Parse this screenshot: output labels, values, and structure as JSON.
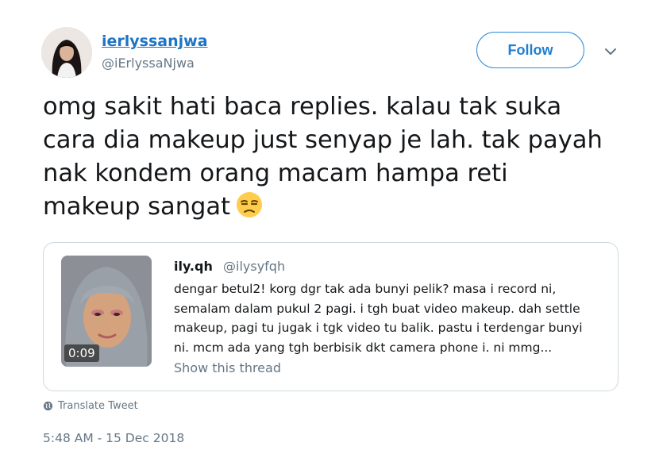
{
  "author": {
    "display_name": "ierlyssanjwa",
    "handle": "@iErlyssaNjwa",
    "avatar": "profile-photo"
  },
  "follow_label": "Follow",
  "tweet": {
    "lines": [
      "omg sakit hati baca replies.  kalau tak suka",
      "cara dia makeup just senyap je lah. tak payah",
      "nak kondem orang macam hampa reti",
      "makeup sangat"
    ],
    "emoji": "unamused-face-emoji"
  },
  "quoted": {
    "name": "ily.qh",
    "handle": "@ilysyfqh",
    "video_duration": "0:09",
    "lines": [
      "dengar betul2! korg dgr tak ada bunyi pelik? masa i record ni,",
      "semalam dalam pukul 2 pagi. i tgh buat video makeup. dah settle",
      "makeup, pagi tu jugak i tgk video tu balik. pastu i terdengar bunyi",
      "ni. mcm ada yang tgh berbisik dkt camera phone i. ni mmg..."
    ],
    "show_thread": "Show this thread"
  },
  "translate_label": "Translate Tweet",
  "timestamp": "5:48 AM - 15 Dec 2018",
  "colors": {
    "link_blue": "#1f74c4",
    "secondary_gray": "#657786",
    "border": "#cfd9de"
  }
}
